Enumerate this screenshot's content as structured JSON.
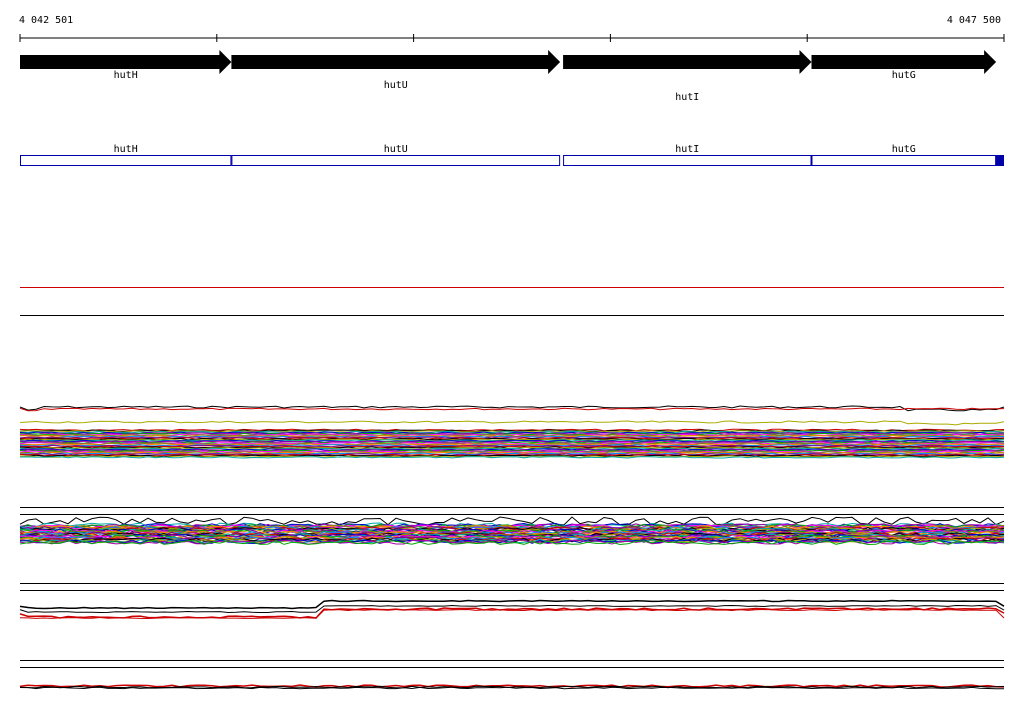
{
  "coordinates": {
    "start_label": "4 042 501",
    "end_label": "4 047 500",
    "start": 4042501,
    "end": 4047500
  },
  "genes": [
    {
      "name": "hutH",
      "start": 4042501,
      "end": 4043575
    },
    {
      "name": "hutU",
      "start": 4043575,
      "end": 4045245
    },
    {
      "name": "hutI",
      "start": 4045260,
      "end": 4046522
    },
    {
      "name": "hutG",
      "start": 4046522,
      "end": 4047460
    }
  ],
  "gene_boxes": [
    {
      "name": "hutH",
      "start": 4042501,
      "end": 4043575
    },
    {
      "name": "hutU",
      "start": 4043575,
      "end": 4045245
    },
    {
      "name": "hutI",
      "start": 4045260,
      "end": 4046522
    },
    {
      "name": "hutG",
      "start": 4046522,
      "end": 4047460
    }
  ],
  "colors": {
    "gene_arrow": "#000000",
    "gene_box": "#0000aa",
    "track_separator": "#000000",
    "red_line": "#cc0000",
    "palette": [
      "#cc0000",
      "#000000",
      "#aaaa00",
      "#00aaaa",
      "#0000cc",
      "#aa00aa",
      "#00aa00",
      "#ff00ff",
      "#888800",
      "#ff8800",
      "#0088ff",
      "#880088"
    ]
  },
  "expression_tracks": [
    {
      "name": "track-1",
      "line_count": 40
    },
    {
      "name": "track-2",
      "line_count": 40
    },
    {
      "name": "track-3",
      "line_count": 4
    },
    {
      "name": "track-4",
      "line_count": 3
    }
  ]
}
